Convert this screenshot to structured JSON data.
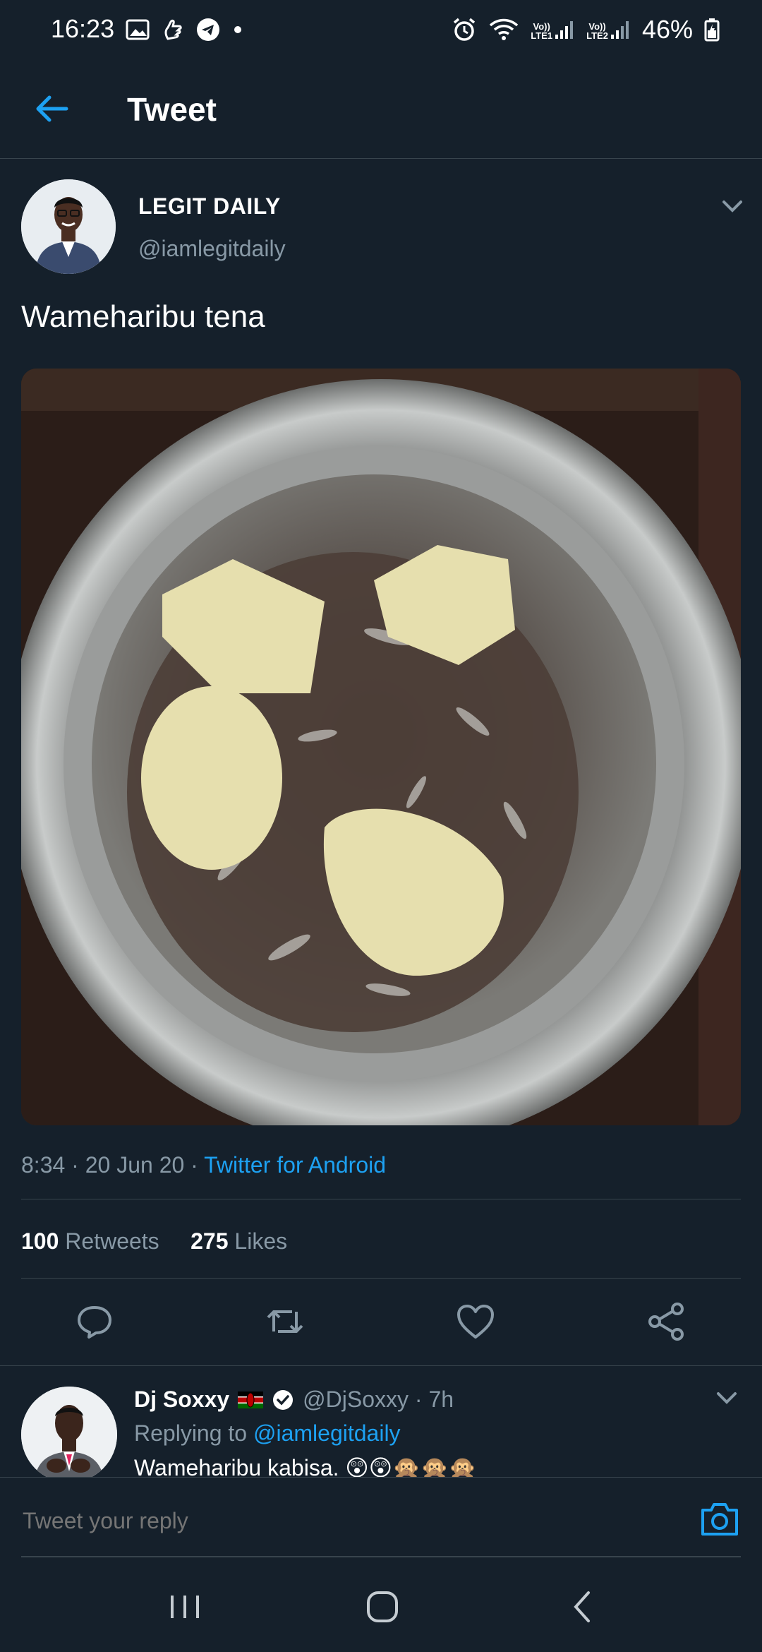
{
  "status_bar": {
    "time": "16:23",
    "battery": "46%",
    "lte1": "LTE1",
    "lte2": "LTE2",
    "volte": "Vo))"
  },
  "header": {
    "title": "Tweet"
  },
  "tweet": {
    "name": "LEGIT DAILY",
    "handle": "@iamlegitdaily",
    "text": "Wameharibu tena",
    "time": "8:34 · 20 Jun 20 · ",
    "source": "Twitter for Android",
    "retweets_count": "100",
    "retweets_label": "Retweets",
    "likes_count": "275",
    "likes_label": "Likes"
  },
  "reply": {
    "name": "Dj Soxxy",
    "handle": "@DjSoxxy · 7h",
    "replying_prefix": "Replying to ",
    "replying_to": "@iamlegitdaily",
    "text": "Wameharibu kabisa. 😲😲🙊🙊🙊"
  },
  "composer": {
    "placeholder": "Tweet your reply"
  },
  "colors": {
    "background": "#15202b",
    "accent": "#1da1f2",
    "muted": "#8899a6",
    "divider": "#38444d"
  },
  "icons": [
    "back-arrow-icon",
    "chevron-down-icon",
    "reply-icon",
    "retweet-icon",
    "like-icon",
    "share-icon",
    "verified-icon",
    "camera-icon"
  ]
}
